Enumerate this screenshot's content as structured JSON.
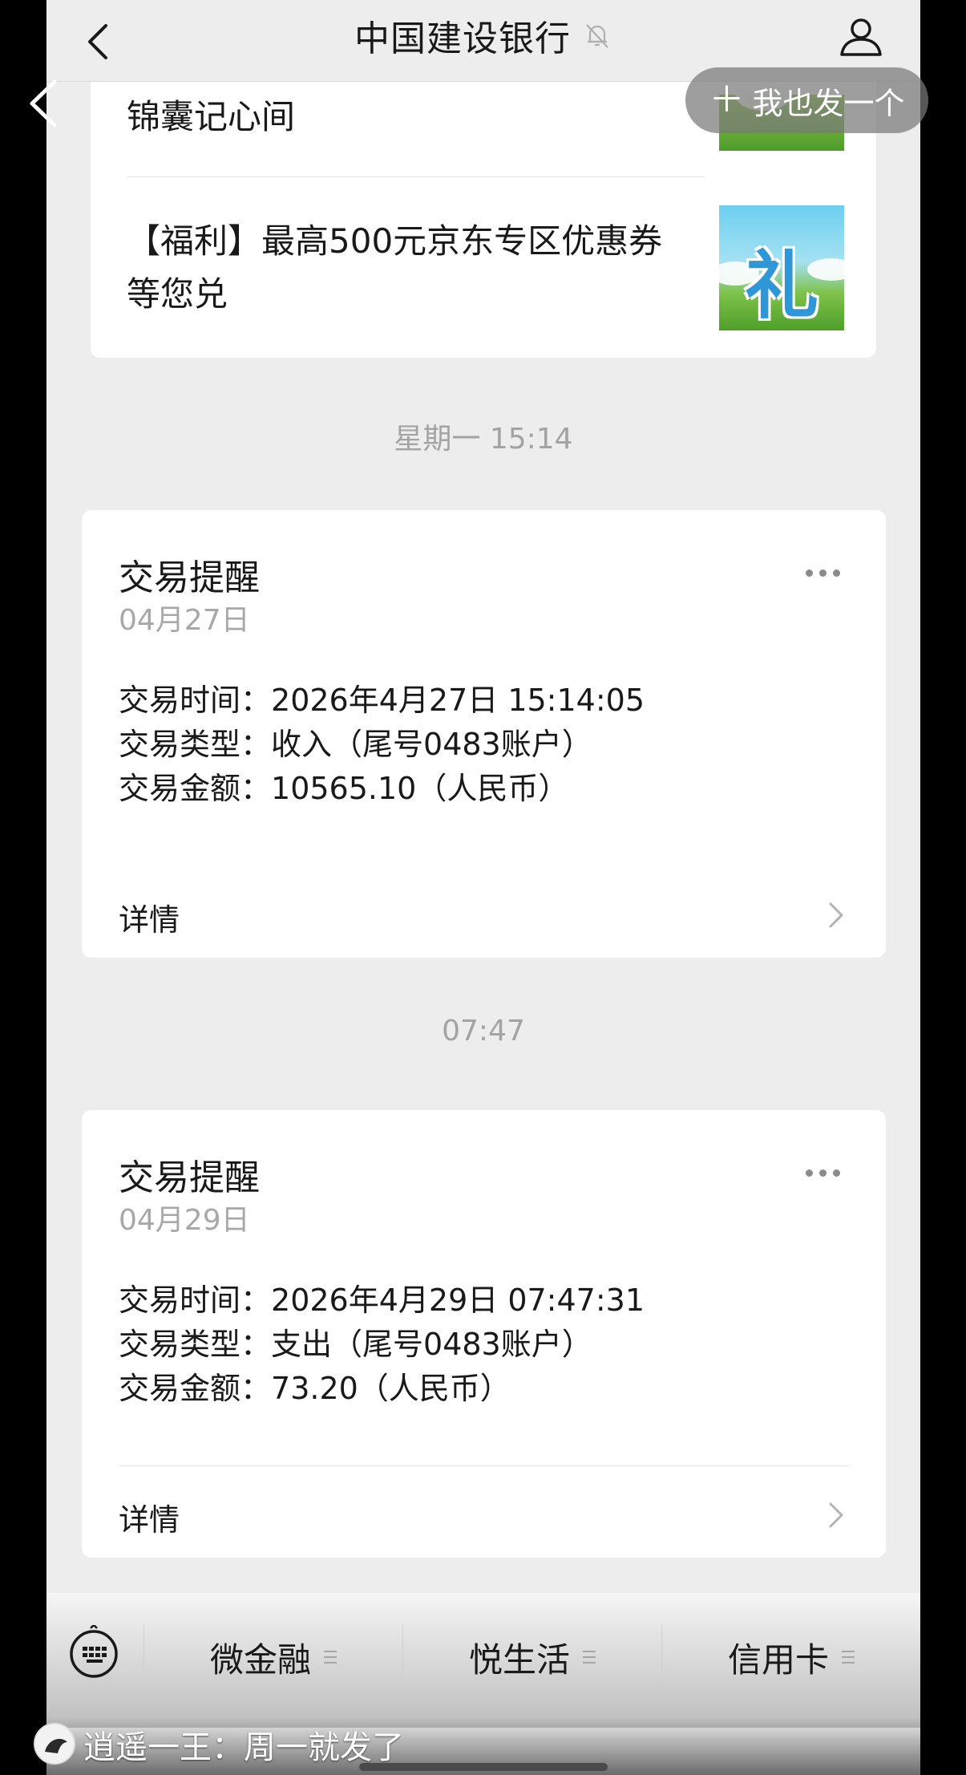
{
  "header": {
    "title": "中国建设银行"
  },
  "overlay": {
    "share_label": "我也发一个",
    "plus": "＋"
  },
  "news": {
    "item1_title": "锦囊记心间",
    "item2_title": "【福利】最高500元京东专区优惠券等您兑",
    "item2_thumb_char": "礼"
  },
  "separators": {
    "first": "星期一 15:14",
    "second": "07:47"
  },
  "transactions": [
    {
      "title": "交易提醒",
      "date": "04月27日",
      "time_label": "交易时间：",
      "time_value": "2026年4月27日 15:14:05",
      "type_label": "交易类型：",
      "type_value": "收入（尾号0483账户）",
      "amount_label": "交易金额：",
      "amount_value": "10565.10（人民币）",
      "detail_label": "详情"
    },
    {
      "title": "交易提醒",
      "date": "04月29日",
      "time_label": "交易时间：",
      "time_value": "2026年4月29日 07:47:31",
      "type_label": "交易类型：",
      "type_value": "支出（尾号0483账户）",
      "amount_label": "交易金额：",
      "amount_value": "73.20（人民币）",
      "detail_label": "详情"
    }
  ],
  "menu": {
    "items": [
      "微金融",
      "悦生活",
      "信用卡"
    ]
  },
  "comment": {
    "text": "逍遥一王：周一就发了"
  },
  "colors": {
    "background": "#ededed",
    "card": "#ffffff",
    "text_primary": "#191919",
    "text_secondary": "#a8a8a8"
  }
}
